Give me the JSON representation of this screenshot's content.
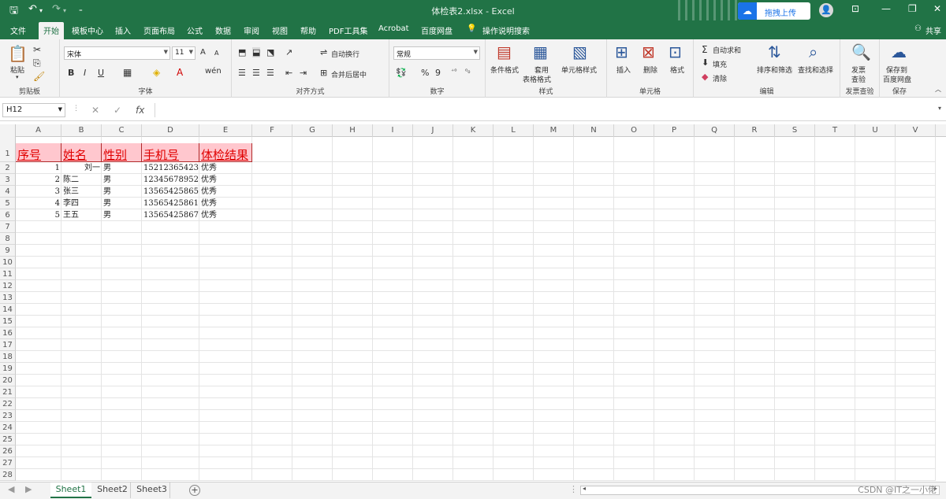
{
  "titlebar": {
    "title": "体检表2.xlsx  -  Excel",
    "upload_label": "拖拽上传",
    "save_icon": "save-icon",
    "undo_icon": "undo-icon",
    "redo_icon": "redo-icon"
  },
  "tabs": [
    "文件",
    "开始",
    "模板中心",
    "插入",
    "页面布局",
    "公式",
    "数据",
    "审阅",
    "视图",
    "帮助",
    "PDF工具集",
    "Acrobat",
    "百度网盘",
    "操作说明搜索"
  ],
  "active_tab": "开始",
  "share_label": "共享",
  "ribbon": {
    "clipboard": {
      "paste": "粘贴",
      "group": "剪贴板"
    },
    "font": {
      "name": "宋体",
      "size": "11",
      "group": "字体",
      "bold": "B",
      "italic": "I",
      "underline": "U",
      "grow": "A",
      "shrink": "A",
      "phonetic": "wén"
    },
    "alignment": {
      "wrap": "自动换行",
      "merge": "合并后居中",
      "group": "对齐方式"
    },
    "number": {
      "format": "常规",
      "percent": "%",
      "comma": "9",
      "group": "数字"
    },
    "styles": {
      "conditional": "条件格式",
      "table": "套用",
      "table2": "表格格式",
      "cell": "单元格样式",
      "group": "样式"
    },
    "cells": {
      "insert": "插入",
      "delete": "删除",
      "format": "格式",
      "group": "单元格"
    },
    "editing": {
      "autosum": "自动求和",
      "fill": "填充",
      "clear": "清除",
      "sort": "排序和筛选",
      "find": "查找和选择",
      "group": "编辑"
    },
    "invoice": {
      "btn1": "发票",
      "btn2": "查验",
      "group": "发票查验"
    },
    "save": {
      "btn1": "保存到",
      "btn2": "百度网盘",
      "group": "保存"
    }
  },
  "namebox": "H12",
  "fx_label": "fx",
  "columns": [
    "A",
    "B",
    "C",
    "D",
    "E",
    "F",
    "G",
    "H",
    "I",
    "J",
    "K",
    "L",
    "M",
    "N",
    "O",
    "P",
    "Q",
    "R",
    "S",
    "T",
    "U",
    "V"
  ],
  "row_numbers": [
    "1",
    "2",
    "3",
    "4",
    "5",
    "6",
    "7",
    "8",
    "9",
    "10",
    "11",
    "12",
    "13",
    "14",
    "15",
    "16",
    "17",
    "18",
    "19",
    "20",
    "21",
    "22",
    "23",
    "24",
    "25",
    "26",
    "27",
    "28"
  ],
  "table": {
    "headers": [
      "序号",
      "姓名",
      "性别",
      "手机号",
      "体检结果"
    ],
    "rows": [
      [
        "1",
        "刘一",
        "男",
        "15212365423",
        "优秀"
      ],
      [
        "2",
        "陈二",
        "男",
        "12345678952",
        "优秀"
      ],
      [
        "3",
        "张三",
        "男",
        "13565425865",
        "优秀"
      ],
      [
        "4",
        "李四",
        "男",
        "13565425861",
        "优秀"
      ],
      [
        "5",
        "王五",
        "男",
        "13565425867",
        "优秀"
      ]
    ]
  },
  "sheets": [
    "Sheet1",
    "Sheet2",
    "Sheet3"
  ],
  "active_sheet": "Sheet1",
  "add_sheet": "+",
  "watermark": "CSDN @IT之一小佬"
}
